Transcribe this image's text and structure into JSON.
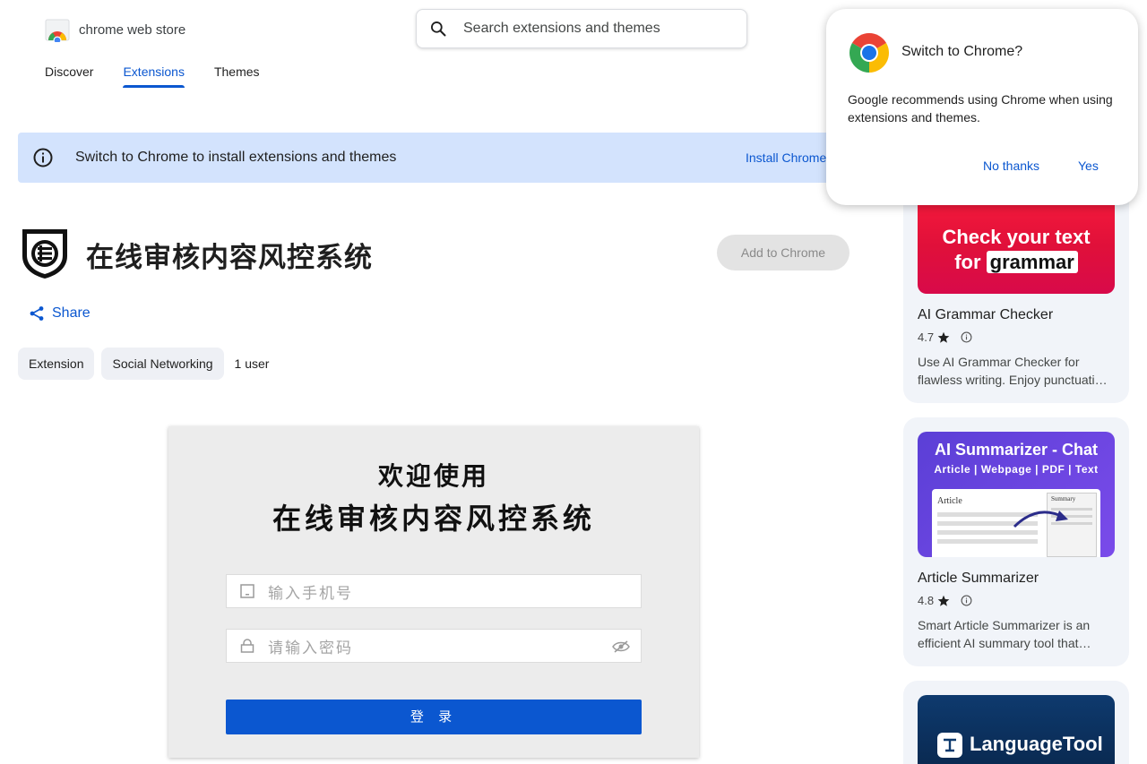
{
  "header": {
    "store_name": "chrome web store",
    "search_placeholder": "Search extensions and themes",
    "tabs": [
      {
        "label": "Discover",
        "active": false
      },
      {
        "label": "Extensions",
        "active": true
      },
      {
        "label": "Themes",
        "active": false
      }
    ]
  },
  "banner": {
    "text": "Switch to Chrome to install extensions and themes",
    "link": "Install Chrome"
  },
  "extension": {
    "title": "在线审核内容风控系统",
    "add_button": "Add to Chrome",
    "share": "Share",
    "chips": [
      "Extension",
      "Social Networking"
    ],
    "users": "1 user"
  },
  "screenshot": {
    "heading1": "欢迎使用",
    "heading2": "在线审核内容风控系统",
    "phone_placeholder": "输入手机号",
    "password_placeholder": "请输入密码",
    "login_button": "登 录"
  },
  "related": [
    {
      "name": "AI Grammar Checker",
      "rating": "4.7",
      "desc": "Use AI Grammar Checker for flawless writing. Enjoy punctuati…",
      "image_line1": "Check your text",
      "image_line2a": "for",
      "image_line2b": "grammar"
    },
    {
      "name": "Article Summarizer",
      "rating": "4.8",
      "desc": "Smart Article Summarizer is an efficient AI summary tool that…",
      "image_title": "AI Summarizer - Chat",
      "image_sub": "Article | Webpage | PDF | Text",
      "image_panel_left": "Article",
      "image_panel_right": "Summary"
    },
    {
      "name": "LanguageTool",
      "image_title": "LanguageTool"
    }
  ],
  "popup": {
    "title": "Switch to Chrome?",
    "body": "Google recommends using Chrome when using extensions and themes.",
    "no": "No thanks",
    "yes": "Yes"
  },
  "colors": {
    "accent": "#0b57d0",
    "banner": "#d3e3fd"
  }
}
